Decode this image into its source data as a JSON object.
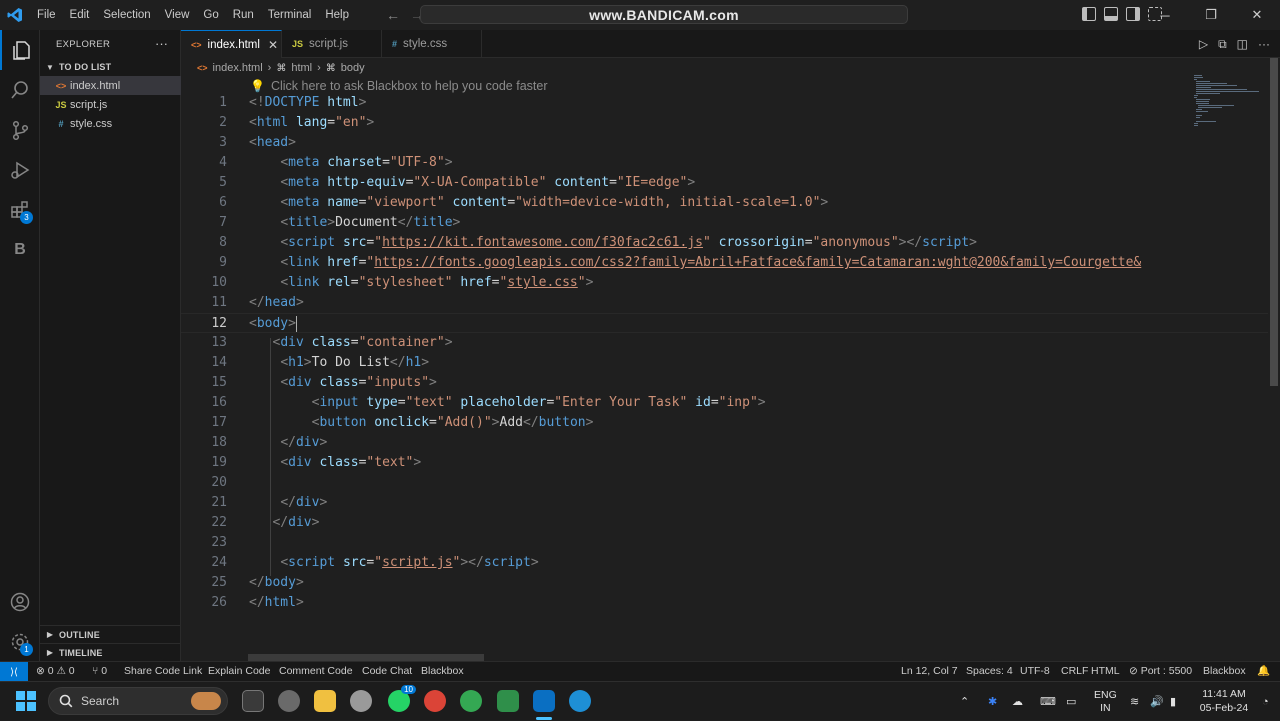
{
  "titlebar": {
    "menu": [
      "File",
      "Edit",
      "Selection",
      "View",
      "Go",
      "Run",
      "Terminal",
      "Help"
    ],
    "watermark": "www.BANDICAM.com"
  },
  "activity_bar": {
    "items": [
      "explorer-icon",
      "search-icon",
      "source-control-icon",
      "run-debug-icon",
      "extensions-icon",
      "blackbox-icon"
    ],
    "extensions_badge": "3",
    "bottom": [
      "accounts-icon",
      "settings-icon"
    ],
    "settings_badge": "1",
    "blackbox_glyph": "B"
  },
  "sidebar": {
    "title": "EXPLORER",
    "more": "···",
    "folder": "TO DO LIST",
    "files": [
      {
        "name": "index.html",
        "icon": "<>",
        "color": "#e37933",
        "selected": true
      },
      {
        "name": "script.js",
        "icon": "JS",
        "color": "#cbcb41"
      },
      {
        "name": "style.css",
        "icon": "#",
        "color": "#519aba"
      }
    ],
    "outline": "OUTLINE",
    "timeline": "TIMELINE"
  },
  "tabs": [
    {
      "label": "index.html",
      "icon": "<>",
      "color": "#e37933",
      "active": true,
      "close": "✕"
    },
    {
      "label": "script.js",
      "icon": "JS",
      "color": "#cbcb41"
    },
    {
      "label": "style.css",
      "icon": "#",
      "color": "#519aba"
    }
  ],
  "breadcrumb": {
    "file": "index.html",
    "sep": "›",
    "html": "html",
    "body": "body"
  },
  "editor": {
    "hint": "Click here to ask Blackbox to help you code faster",
    "current_line": 12,
    "lines": [
      [
        [
          "br",
          "<!"
        ],
        [
          "tag",
          "DOCTYPE"
        ],
        [
          "txt",
          " "
        ],
        [
          "attr",
          "html"
        ],
        [
          "br",
          ">"
        ]
      ],
      [
        [
          "br",
          "<"
        ],
        [
          "tag",
          "html"
        ],
        [
          "txt",
          " "
        ],
        [
          "attr",
          "lang"
        ],
        [
          "txt",
          "="
        ],
        [
          "str",
          "\"en\""
        ],
        [
          "br",
          ">"
        ]
      ],
      [
        [
          "br",
          "<"
        ],
        [
          "tag",
          "head"
        ],
        [
          "br",
          ">"
        ]
      ],
      [
        [
          "txt",
          "    "
        ],
        [
          "br",
          "<"
        ],
        [
          "tag",
          "meta"
        ],
        [
          "txt",
          " "
        ],
        [
          "attr",
          "charset"
        ],
        [
          "txt",
          "="
        ],
        [
          "str",
          "\"UTF-8\""
        ],
        [
          "br",
          ">"
        ]
      ],
      [
        [
          "txt",
          "    "
        ],
        [
          "br",
          "<"
        ],
        [
          "tag",
          "meta"
        ],
        [
          "txt",
          " "
        ],
        [
          "attr",
          "http-equiv"
        ],
        [
          "txt",
          "="
        ],
        [
          "str",
          "\"X-UA-Compatible\""
        ],
        [
          "txt",
          " "
        ],
        [
          "attr",
          "content"
        ],
        [
          "txt",
          "="
        ],
        [
          "str",
          "\"IE=edge\""
        ],
        [
          "br",
          ">"
        ]
      ],
      [
        [
          "txt",
          "    "
        ],
        [
          "br",
          "<"
        ],
        [
          "tag",
          "meta"
        ],
        [
          "txt",
          " "
        ],
        [
          "attr",
          "name"
        ],
        [
          "txt",
          "="
        ],
        [
          "str",
          "\"viewport\""
        ],
        [
          "txt",
          " "
        ],
        [
          "attr",
          "content"
        ],
        [
          "txt",
          "="
        ],
        [
          "str",
          "\"width=device-width, initial-scale=1.0\""
        ],
        [
          "br",
          ">"
        ]
      ],
      [
        [
          "txt",
          "    "
        ],
        [
          "br",
          "<"
        ],
        [
          "tag",
          "title"
        ],
        [
          "br",
          ">"
        ],
        [
          "txt",
          "Document"
        ],
        [
          "br",
          "</"
        ],
        [
          "tag",
          "title"
        ],
        [
          "br",
          ">"
        ]
      ],
      [
        [
          "txt",
          "    "
        ],
        [
          "br",
          "<"
        ],
        [
          "tag",
          "script"
        ],
        [
          "txt",
          " "
        ],
        [
          "attr",
          "src"
        ],
        [
          "txt",
          "="
        ],
        [
          "str",
          "\""
        ],
        [
          "url",
          "https://kit.fontawesome.com/f30fac2c61.js"
        ],
        [
          "str",
          "\""
        ],
        [
          "txt",
          " "
        ],
        [
          "attr",
          "crossorigin"
        ],
        [
          "txt",
          "="
        ],
        [
          "str",
          "\"anonymous\""
        ],
        [
          "br",
          "></"
        ],
        [
          "tag",
          "script"
        ],
        [
          "br",
          ">"
        ]
      ],
      [
        [
          "txt",
          "    "
        ],
        [
          "br",
          "<"
        ],
        [
          "tag",
          "link"
        ],
        [
          "txt",
          " "
        ],
        [
          "attr",
          "href"
        ],
        [
          "txt",
          "="
        ],
        [
          "str",
          "\""
        ],
        [
          "url",
          "https://fonts.googleapis.com/css2?family=Abril+Fatface&family=Catamaran:wght@200&family=Courgette&"
        ]
      ],
      [
        [
          "txt",
          "    "
        ],
        [
          "br",
          "<"
        ],
        [
          "tag",
          "link"
        ],
        [
          "txt",
          " "
        ],
        [
          "attr",
          "rel"
        ],
        [
          "txt",
          "="
        ],
        [
          "str",
          "\"stylesheet\""
        ],
        [
          "txt",
          " "
        ],
        [
          "attr",
          "href"
        ],
        [
          "txt",
          "="
        ],
        [
          "str",
          "\""
        ],
        [
          "url",
          "style.css"
        ],
        [
          "str",
          "\""
        ],
        [
          "br",
          ">"
        ]
      ],
      [
        [
          "br",
          "</"
        ],
        [
          "tag",
          "head"
        ],
        [
          "br",
          ">"
        ]
      ],
      [
        [
          "br",
          "<"
        ],
        [
          "tag",
          "body"
        ],
        [
          "br",
          ">"
        ]
      ],
      [
        [
          "txt",
          "   "
        ],
        [
          "br",
          "<"
        ],
        [
          "tag",
          "div"
        ],
        [
          "txt",
          " "
        ],
        [
          "attr",
          "class"
        ],
        [
          "txt",
          "="
        ],
        [
          "str",
          "\"container\""
        ],
        [
          "br",
          ">"
        ]
      ],
      [
        [
          "txt",
          "    "
        ],
        [
          "br",
          "<"
        ],
        [
          "tag",
          "h1"
        ],
        [
          "br",
          ">"
        ],
        [
          "txt",
          "To Do List"
        ],
        [
          "br",
          "</"
        ],
        [
          "tag",
          "h1"
        ],
        [
          "br",
          ">"
        ]
      ],
      [
        [
          "txt",
          "    "
        ],
        [
          "br",
          "<"
        ],
        [
          "tag",
          "div"
        ],
        [
          "txt",
          " "
        ],
        [
          "attr",
          "class"
        ],
        [
          "txt",
          "="
        ],
        [
          "str",
          "\"inputs\""
        ],
        [
          "br",
          ">"
        ]
      ],
      [
        [
          "txt",
          "        "
        ],
        [
          "br",
          "<"
        ],
        [
          "tag",
          "input"
        ],
        [
          "txt",
          " "
        ],
        [
          "attr",
          "type"
        ],
        [
          "txt",
          "="
        ],
        [
          "str",
          "\"text\""
        ],
        [
          "txt",
          " "
        ],
        [
          "attr",
          "placeholder"
        ],
        [
          "txt",
          "="
        ],
        [
          "str",
          "\"Enter Your Task\""
        ],
        [
          "txt",
          " "
        ],
        [
          "attr",
          "id"
        ],
        [
          "txt",
          "="
        ],
        [
          "str",
          "\"inp\""
        ],
        [
          "br",
          ">"
        ]
      ],
      [
        [
          "txt",
          "        "
        ],
        [
          "br",
          "<"
        ],
        [
          "tag",
          "button"
        ],
        [
          "txt",
          " "
        ],
        [
          "attr",
          "onclick"
        ],
        [
          "txt",
          "="
        ],
        [
          "str",
          "\"Add()\""
        ],
        [
          "br",
          ">"
        ],
        [
          "txt",
          "Add"
        ],
        [
          "br",
          "</"
        ],
        [
          "tag",
          "button"
        ],
        [
          "br",
          ">"
        ]
      ],
      [
        [
          "txt",
          "    "
        ],
        [
          "br",
          "</"
        ],
        [
          "tag",
          "div"
        ],
        [
          "br",
          ">"
        ]
      ],
      [
        [
          "txt",
          "    "
        ],
        [
          "br",
          "<"
        ],
        [
          "tag",
          "div"
        ],
        [
          "txt",
          " "
        ],
        [
          "attr",
          "class"
        ],
        [
          "txt",
          "="
        ],
        [
          "str",
          "\"text\""
        ],
        [
          "br",
          ">"
        ]
      ],
      [],
      [
        [
          "txt",
          "    "
        ],
        [
          "br",
          "</"
        ],
        [
          "tag",
          "div"
        ],
        [
          "br",
          ">"
        ]
      ],
      [
        [
          "txt",
          "   "
        ],
        [
          "br",
          "</"
        ],
        [
          "tag",
          "div"
        ],
        [
          "br",
          ">"
        ]
      ],
      [],
      [
        [
          "txt",
          "    "
        ],
        [
          "br",
          "<"
        ],
        [
          "tag",
          "script"
        ],
        [
          "txt",
          " "
        ],
        [
          "attr",
          "src"
        ],
        [
          "txt",
          "="
        ],
        [
          "str",
          "\""
        ],
        [
          "url",
          "script.js"
        ],
        [
          "str",
          "\""
        ],
        [
          "br",
          "></"
        ],
        [
          "tag",
          "script"
        ],
        [
          "br",
          ">"
        ]
      ],
      [
        [
          "br",
          "</"
        ],
        [
          "tag",
          "body"
        ],
        [
          "br",
          ">"
        ]
      ],
      [
        [
          "br",
          "</"
        ],
        [
          "tag",
          "html"
        ],
        [
          "br",
          ">"
        ]
      ]
    ]
  },
  "statusbar": {
    "left": [
      {
        "name": "problems",
        "text": "⊗ 0 ⚠ 0"
      },
      {
        "name": "ports",
        "text": "⑂ 0"
      },
      {
        "name": "share-code-link",
        "text": "Share Code Link"
      },
      {
        "name": "explain-code",
        "text": "Explain Code"
      },
      {
        "name": "comment-code",
        "text": "Comment Code"
      },
      {
        "name": "code-chat",
        "text": "Code Chat"
      },
      {
        "name": "blackbox",
        "text": "Blackbox"
      }
    ],
    "right": [
      {
        "name": "cursor-position",
        "text": "Ln 12, Col 7"
      },
      {
        "name": "indentation",
        "text": "Spaces: 4"
      },
      {
        "name": "encoding",
        "text": "UTF-8"
      },
      {
        "name": "eol",
        "text": "CRLF"
      },
      {
        "name": "language",
        "text": "HTML"
      },
      {
        "name": "live-server-port",
        "text": "⊘ Port : 5500"
      },
      {
        "name": "blackbox-right",
        "text": "Blackbox"
      }
    ]
  },
  "taskbar": {
    "search": "Search",
    "whatsapp_badge": "10",
    "lang_line1": "ENG",
    "lang_line2": "IN",
    "time": "11:41 AM",
    "date": "05-Feb-24"
  }
}
